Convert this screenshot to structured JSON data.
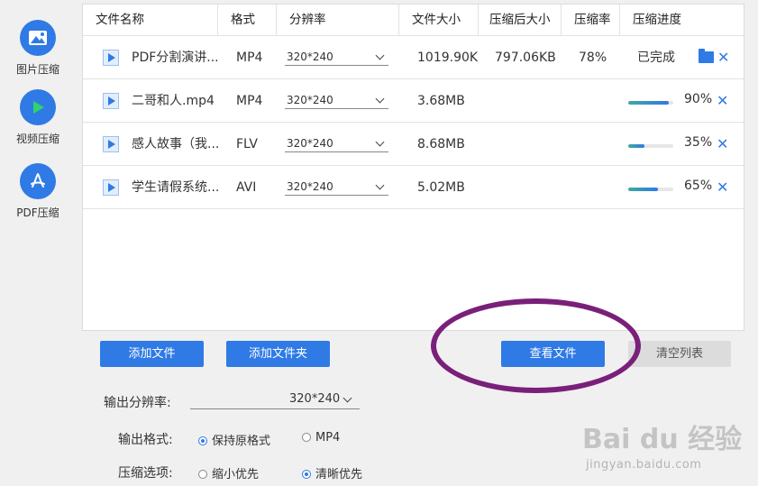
{
  "sidebar": {
    "items": [
      {
        "label": "图片压缩",
        "icon": "image-icon"
      },
      {
        "label": "视频压缩",
        "icon": "play-icon"
      },
      {
        "label": "PDF压缩",
        "icon": "pdf-icon"
      }
    ]
  },
  "table": {
    "headers": [
      "文件名称",
      "格式",
      "分辨率",
      "文件大小",
      "压缩后大小",
      "压缩率",
      "压缩进度"
    ],
    "rows": [
      {
        "name": "PDF分割演讲...",
        "format": "MP4",
        "resolution": "320*240",
        "size": "1019.90KB",
        "compressed": "797.06KB",
        "ratio": "78%",
        "status": "已完成",
        "progress": 100
      },
      {
        "name": "二哥和人.mp4",
        "format": "MP4",
        "resolution": "320*240",
        "size": "3.68MB",
        "compressed": "",
        "ratio": "",
        "status": "90%",
        "progress": 90
      },
      {
        "name": "感人故事（我...",
        "format": "FLV",
        "resolution": "320*240",
        "size": "8.68MB",
        "compressed": "",
        "ratio": "",
        "status": "35%",
        "progress": 35
      },
      {
        "name": "学生请假系统...",
        "format": "AVI",
        "resolution": "320*240",
        "size": "5.02MB",
        "compressed": "",
        "ratio": "",
        "status": "65%",
        "progress": 65
      }
    ]
  },
  "buttons": {
    "add_file": "添加文件",
    "add_folder": "添加文件夹",
    "view_files": "查看文件",
    "clear_list": "清空列表"
  },
  "options": {
    "resolution_label": "输出分辨率:",
    "resolution_value": "320*240",
    "format_label": "输出格式:",
    "format_keep": "保持原格式",
    "format_mp4": "MP4",
    "compress_label": "压缩选项:",
    "compress_small": "缩小优先",
    "compress_clear": "清晰优先"
  },
  "watermark": {
    "text": "Bai du 经验",
    "sub": "jingyan.baidu.com"
  },
  "colors": {
    "accent": "#2f7ae5",
    "annotation": "#7a1f7a"
  }
}
